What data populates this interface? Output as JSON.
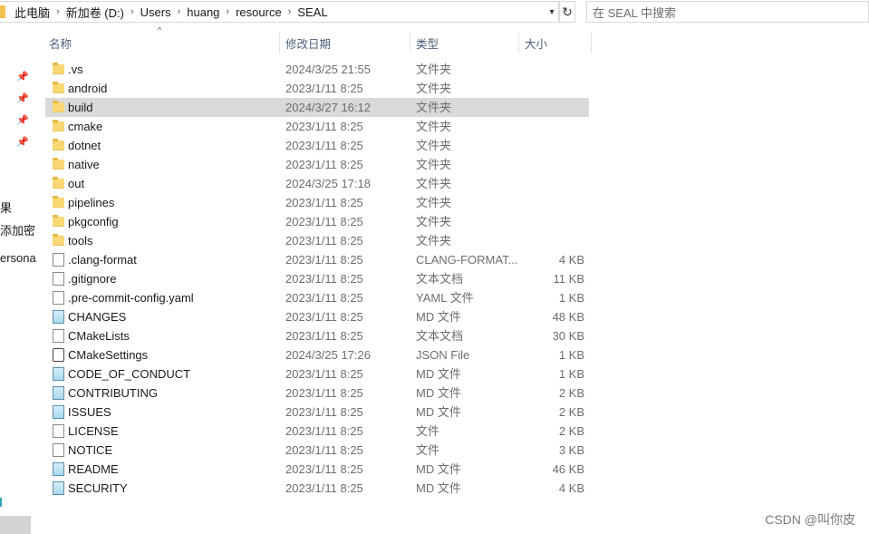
{
  "address": {
    "crumbs": [
      "此电脑",
      "新加卷 (D:)",
      "Users",
      "huang",
      "resource",
      "SEAL"
    ]
  },
  "search": {
    "placeholder": "在 SEAL 中搜索"
  },
  "nav_pane": {
    "texts": [
      "果",
      "添加密",
      "ersona"
    ]
  },
  "columns": {
    "name": "名称",
    "date": "修改日期",
    "type": "类型",
    "size": "大小"
  },
  "files": [
    {
      "name": ".vs",
      "date": "2024/3/25 21:55",
      "type": "文件夹",
      "size": "",
      "icon": "folder-icon"
    },
    {
      "name": "android",
      "date": "2023/1/11 8:25",
      "type": "文件夹",
      "size": "",
      "icon": "folder-icon"
    },
    {
      "name": "build",
      "date": "2024/3/27 16:12",
      "type": "文件夹",
      "size": "",
      "icon": "folder-icon",
      "selected": true
    },
    {
      "name": "cmake",
      "date": "2023/1/11 8:25",
      "type": "文件夹",
      "size": "",
      "icon": "folder-icon"
    },
    {
      "name": "dotnet",
      "date": "2023/1/11 8:25",
      "type": "文件夹",
      "size": "",
      "icon": "folder-icon"
    },
    {
      "name": "native",
      "date": "2023/1/11 8:25",
      "type": "文件夹",
      "size": "",
      "icon": "folder-icon"
    },
    {
      "name": "out",
      "date": "2024/3/25 17:18",
      "type": "文件夹",
      "size": "",
      "icon": "folder-icon"
    },
    {
      "name": "pipelines",
      "date": "2023/1/11 8:25",
      "type": "文件夹",
      "size": "",
      "icon": "folder-icon"
    },
    {
      "name": "pkgconfig",
      "date": "2023/1/11 8:25",
      "type": "文件夹",
      "size": "",
      "icon": "folder-icon"
    },
    {
      "name": "tools",
      "date": "2023/1/11 8:25",
      "type": "文件夹",
      "size": "",
      "icon": "folder-icon"
    },
    {
      "name": ".clang-format",
      "date": "2023/1/11 8:25",
      "type": "CLANG-FORMAT...",
      "size": "4 KB",
      "icon": "file-icon"
    },
    {
      "name": ".gitignore",
      "date": "2023/1/11 8:25",
      "type": "文本文档",
      "size": "11 KB",
      "icon": "text-file-icon"
    },
    {
      "name": ".pre-commit-config.yaml",
      "date": "2023/1/11 8:25",
      "type": "YAML 文件",
      "size": "1 KB",
      "icon": "file-icon"
    },
    {
      "name": "CHANGES",
      "date": "2023/1/11 8:25",
      "type": "MD 文件",
      "size": "48 KB",
      "icon": "md-file-icon"
    },
    {
      "name": "CMakeLists",
      "date": "2023/1/11 8:25",
      "type": "文本文档",
      "size": "30 KB",
      "icon": "text-file-icon"
    },
    {
      "name": "CMakeSettings",
      "date": "2024/3/25 17:26",
      "type": "JSON File",
      "size": "1 KB",
      "icon": "json-file-icon"
    },
    {
      "name": "CODE_OF_CONDUCT",
      "date": "2023/1/11 8:25",
      "type": "MD 文件",
      "size": "1 KB",
      "icon": "md-file-icon"
    },
    {
      "name": "CONTRIBUTING",
      "date": "2023/1/11 8:25",
      "type": "MD 文件",
      "size": "2 KB",
      "icon": "md-file-icon"
    },
    {
      "name": "ISSUES",
      "date": "2023/1/11 8:25",
      "type": "MD 文件",
      "size": "2 KB",
      "icon": "md-file-icon"
    },
    {
      "name": "LICENSE",
      "date": "2023/1/11 8:25",
      "type": "文件",
      "size": "2 KB",
      "icon": "file-icon"
    },
    {
      "name": "NOTICE",
      "date": "2023/1/11 8:25",
      "type": "文件",
      "size": "3 KB",
      "icon": "file-icon"
    },
    {
      "name": "README",
      "date": "2023/1/11 8:25",
      "type": "MD 文件",
      "size": "46 KB",
      "icon": "md-file-icon"
    },
    {
      "name": "SECURITY",
      "date": "2023/1/11 8:25",
      "type": "MD 文件",
      "size": "4 KB",
      "icon": "md-file-icon"
    }
  ],
  "watermark": "CSDN @叫你皮",
  "colors": {
    "selected_row": "#d9d9d9",
    "folder": "#f8d775",
    "header_text": "#4c607a"
  }
}
